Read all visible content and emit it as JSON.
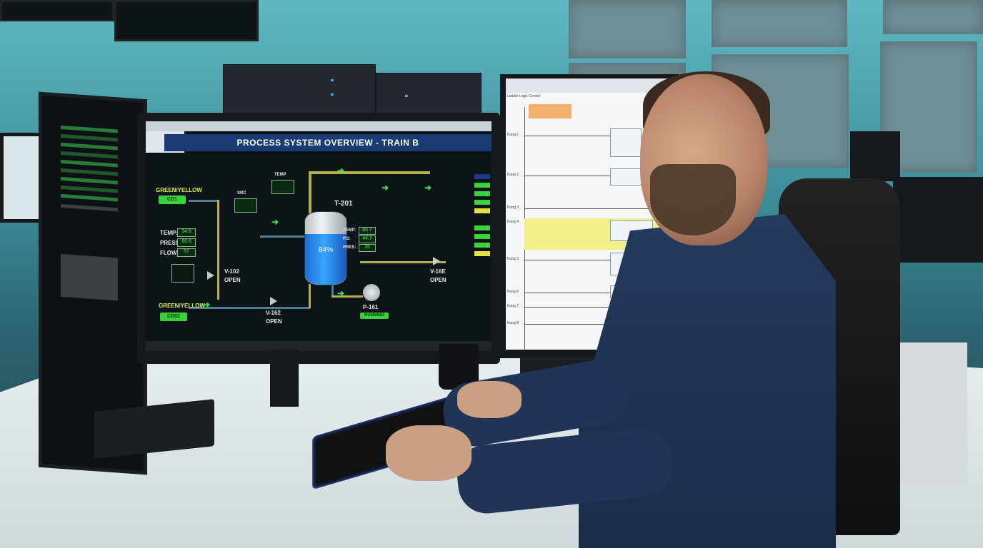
{
  "scene": {
    "description_tags": [
      "control-room",
      "operator",
      "hmi"
    ],
    "accent_color": "#39d23a",
    "title_bar_color": "#1a3c74"
  },
  "hmi": {
    "title": "PROCESS SYSTEM OVERVIEW - TRAIN B",
    "tank": {
      "name": "T-201",
      "level": "84%"
    },
    "inlet_top": {
      "label": "GREEN/YELLOW",
      "value": "CD1"
    },
    "inlet_bottom": {
      "label": "GREEN/YELLOW",
      "value": "CD02"
    },
    "left_readouts": [
      {
        "label": "TEMP:",
        "value": "34.6"
      },
      {
        "label": "PRESS:",
        "value": "80.6"
      },
      {
        "label": "FLOW:",
        "value": "57"
      }
    ],
    "valves": [
      {
        "id": "V-102",
        "state": "OPEN"
      },
      {
        "id": "V-162",
        "state": "OPEN"
      },
      {
        "id": "V-16E",
        "state": "OPEN"
      }
    ],
    "pump": {
      "id": "P-161",
      "state": "RUNNING"
    },
    "top_labels": [
      "TEMP",
      "SRC"
    ],
    "tank_readouts": [
      {
        "label": "TEMP:",
        "value": "86.7"
      },
      {
        "label": "P.S:",
        "value": "44.7"
      },
      {
        "label": "PRES:",
        "value": "35"
      }
    ]
  },
  "ladder": {
    "window_title": "Ladder Logic Control",
    "rungs": [
      "Rung 1",
      "Rung 2",
      "Rung 3",
      "Rung 4",
      "Rung 5",
      "Rung 6",
      "Rung 7",
      "Rung 8"
    ]
  }
}
